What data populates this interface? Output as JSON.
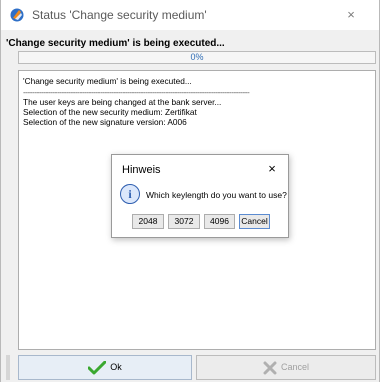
{
  "window": {
    "title": "Status 'Change security medium'",
    "close_glyph": "×",
    "status_line": "'Change security medium' is being executed...",
    "progress_text": "0%",
    "progress_value": 0
  },
  "log": {
    "lines": [
      "'Change security medium' is being executed...",
      "----------------------------------------------------------------------------------------------------",
      "The user keys are being changed at the bank server...",
      "Selection of the new security medium: Zertifikat",
      "Selection of the new signature version: A006"
    ]
  },
  "buttons": {
    "ok_label": "Ok",
    "cancel_label": "Cancel"
  },
  "dialog": {
    "title": "Hinweis",
    "close_glyph": "×",
    "icon_glyph": "i",
    "message": "Which keylength do you want to use?",
    "options": [
      "2048",
      "3072",
      "4096",
      "Cancel"
    ]
  },
  "icons": {
    "app": "app-logo-icon",
    "ok": "checkmark-icon",
    "cancel": "x-icon",
    "dialog": "info-icon"
  },
  "colors": {
    "progress_text": "#2f6db5",
    "ok_check": "#3aa82f",
    "info": "#2f5fb0"
  }
}
